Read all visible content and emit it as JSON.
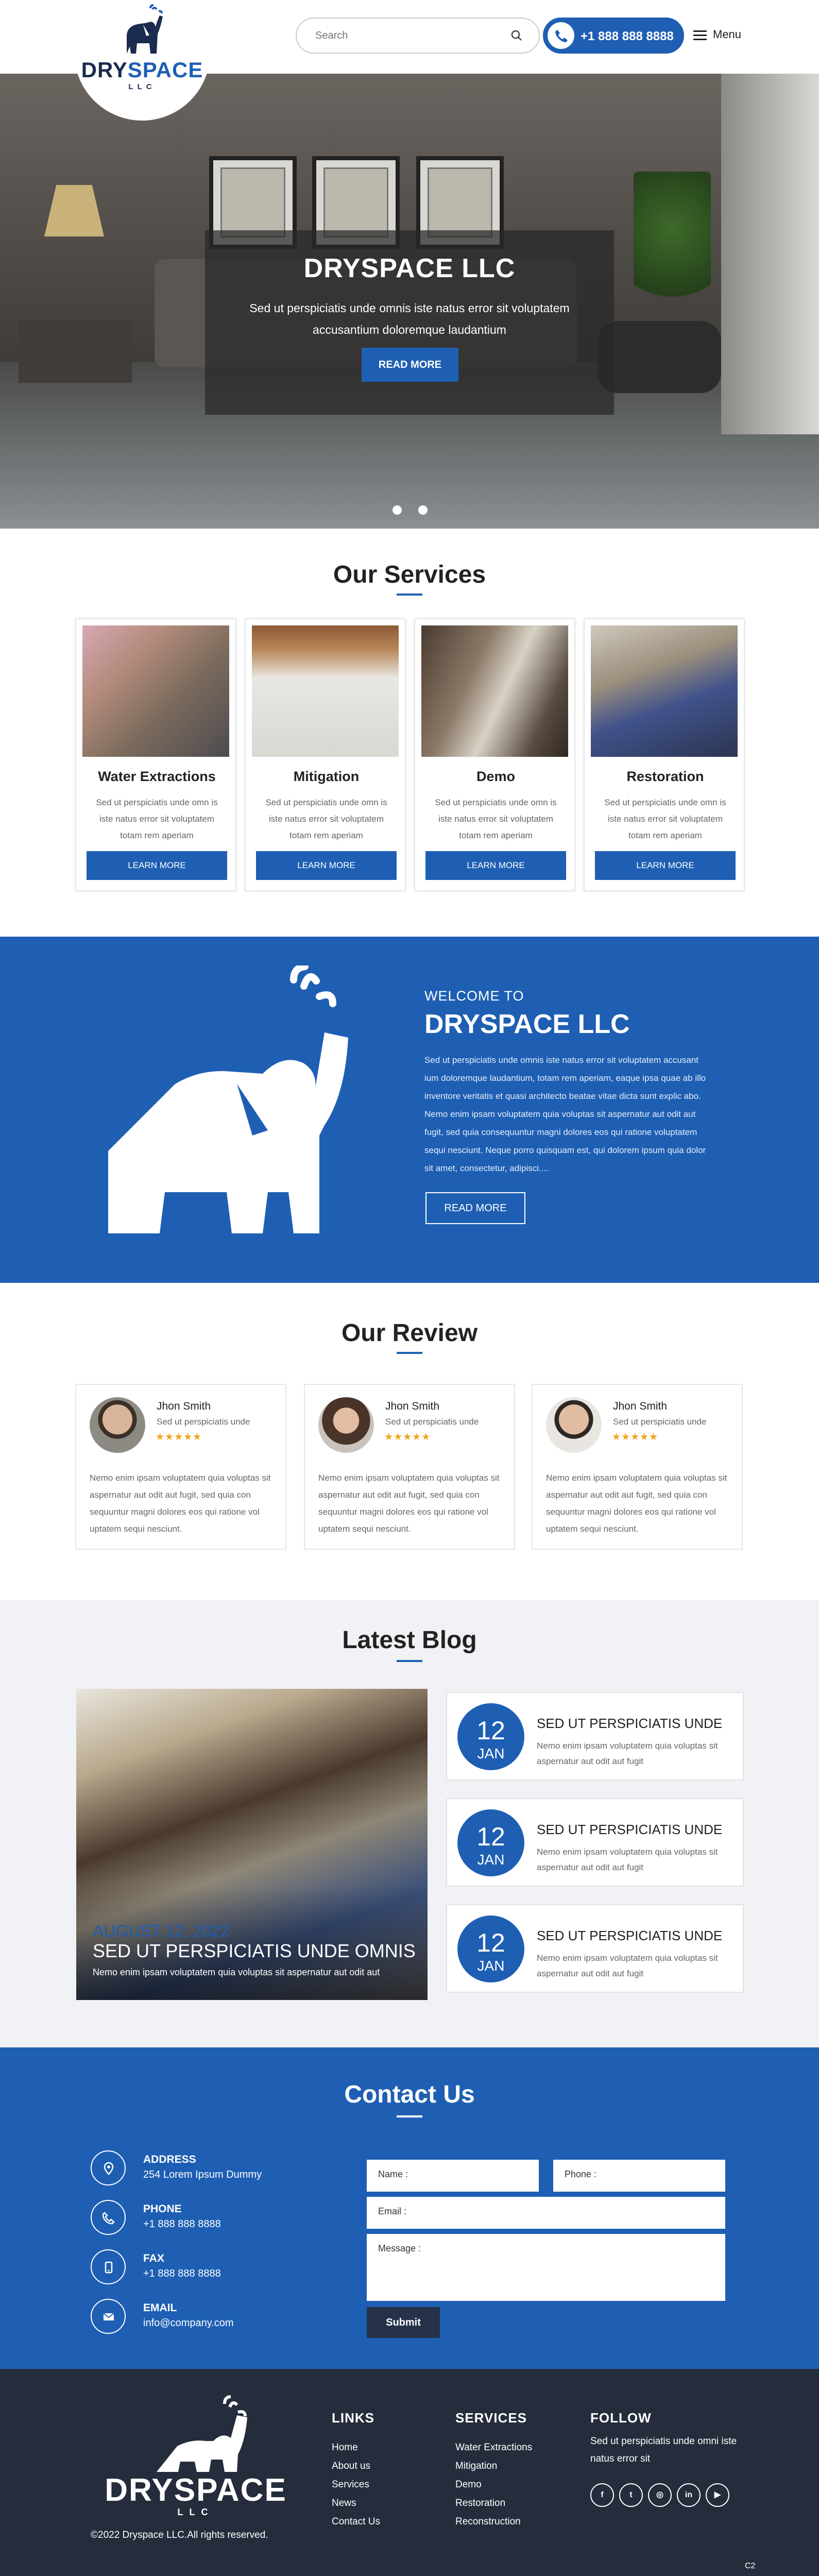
{
  "header": {
    "logo_brand_dry": "DRY",
    "logo_brand_space": "SPACE",
    "logo_llc": "LLC",
    "search_placeholder": "Search",
    "phone": "+1 888 888 8888",
    "menu_label": "Menu"
  },
  "hero": {
    "title": "DRYSPACE LLC",
    "subtitle": "Sed ut perspiciatis unde omnis iste natus error sit voluptatem accusantium doloremque laudantium",
    "button": "READ MORE",
    "slides": 2
  },
  "services": {
    "heading": "Our Services",
    "items": [
      {
        "title": "Water Extractions",
        "desc": "Sed ut perspiciatis unde omn is iste natus error sit voluptatem totam rem aperiam",
        "button": "LEARN MORE"
      },
      {
        "title": "Mitigation",
        "desc": "Sed ut perspiciatis unde omn is iste natus error sit voluptatem totam rem aperiam",
        "button": "LEARN MORE"
      },
      {
        "title": "Demo",
        "desc": "Sed ut perspiciatis unde omn is iste natus error sit voluptatem totam rem aperiam",
        "button": "LEARN MORE"
      },
      {
        "title": "Restoration",
        "desc": "Sed ut perspiciatis unde omn is iste natus error sit voluptatem totam rem aperiam",
        "button": "LEARN MORE"
      }
    ]
  },
  "welcome": {
    "kicker": "WELCOME TO",
    "title": "DRYSPACE LLC",
    "body": "Sed ut perspiciatis unde omnis iste natus error sit voluptatem accusant ium doloremque laudantium, totam rem aperiam, eaque ipsa quae ab illo inventore veritatis et quasi architecto beatae vitae dicta sunt explic abo. Nemo enim ipsam voluptatem quia voluptas sit aspernatur aut odit aut fugit, sed quia consequuntur magni dolores eos qui ratione voluptatem sequi nesciunt. Neque porro quisquam est, qui dolorem ipsum quia dolor sit amet, consectetur, adipisci....",
    "button": "READ MORE"
  },
  "reviews": {
    "heading": "Our Review",
    "items": [
      {
        "name": "Jhon Smith",
        "role": "Sed ut perspiciatis unde",
        "stars": "★★★★★",
        "rating": 5,
        "text": "Nemo enim ipsam voluptatem quia voluptas sit aspernatur aut odit aut fugit, sed quia con sequuntur magni dolores eos qui ratione vol uptatem sequi nesciunt."
      },
      {
        "name": "Jhon Smith",
        "role": "Sed ut perspiciatis unde",
        "stars": "★★★★★",
        "rating": 5,
        "text": "Nemo enim ipsam voluptatem quia voluptas sit aspernatur aut odit aut fugit, sed quia con sequuntur magni dolores eos qui ratione vol uptatem sequi nesciunt."
      },
      {
        "name": "Jhon Smith",
        "role": "Sed ut perspiciatis unde",
        "stars": "★★★★★",
        "rating": 5,
        "text": "Nemo enim ipsam voluptatem quia voluptas sit aspernatur aut odit aut fugit, sed quia con sequuntur magni dolores eos qui ratione vol uptatem sequi nesciunt."
      }
    ]
  },
  "blog": {
    "heading": "Latest Blog",
    "featured": {
      "date": "AUGUST 12, 2022",
      "title": "SED UT PERSPICIATIS UNDE OMNIS",
      "desc": "Nemo enim ipsam voluptatem quia voluptas sit aspernatur aut odit aut"
    },
    "posts": [
      {
        "day": "12",
        "month": "JAN",
        "title": "SED UT PERSPICIATIS UNDE",
        "desc": "Nemo enim ipsam voluptatem quia voluptas sit aspernatur aut odit aut fugit"
      },
      {
        "day": "12",
        "month": "JAN",
        "title": "SED UT PERSPICIATIS UNDE",
        "desc": "Nemo enim ipsam voluptatem quia voluptas sit aspernatur aut odit aut fugit"
      },
      {
        "day": "12",
        "month": "JAN",
        "title": "SED UT PERSPICIATIS UNDE",
        "desc": "Nemo enim ipsam voluptatem quia voluptas sit aspernatur aut odit aut fugit"
      }
    ]
  },
  "contact": {
    "heading": "Contact Us",
    "address_label": "ADDRESS",
    "address": "254 Lorem Ipsum Dummy",
    "phone_label": "PHONE",
    "phone": "+1 888 888 8888",
    "fax_label": "FAX",
    "fax": "+1 888 888 8888",
    "email_label": "EMAIL",
    "email": "info@company.com",
    "form": {
      "name": "Name :",
      "phone": "Phone :",
      "email": "Email :",
      "message": "Message :",
      "submit": "Submit"
    }
  },
  "footer": {
    "brand": "DRYSPACE",
    "llc": "LLC",
    "links_heading": "LINKS",
    "links": [
      "Home",
      "About us",
      "Services",
      "News",
      "Contact Us"
    ],
    "services_heading": "SERVICES",
    "services": [
      "Water Extractions",
      "Mitigation",
      "Demo",
      "Restoration",
      "Reconstruction"
    ],
    "follow_heading": "FOLLOW",
    "follow_text": "Sed ut perspiciatis unde omni iste natus error sit",
    "social": [
      {
        "icon": "facebook-icon",
        "glyph": "f"
      },
      {
        "icon": "twitter-icon",
        "glyph": "t"
      },
      {
        "icon": "instagram-icon",
        "glyph": "◎"
      },
      {
        "icon": "linkedin-icon",
        "glyph": "in"
      },
      {
        "icon": "youtube-icon",
        "glyph": "▶"
      }
    ],
    "copyright": "©2022 Dryspace LLC.All rights reserved.",
    "corner": "C2"
  },
  "colors": {
    "brand_blue": "#1e5fb3",
    "navy": "#1b2b4f",
    "footer_bg": "#252d3c",
    "star": "#f2a31a"
  }
}
